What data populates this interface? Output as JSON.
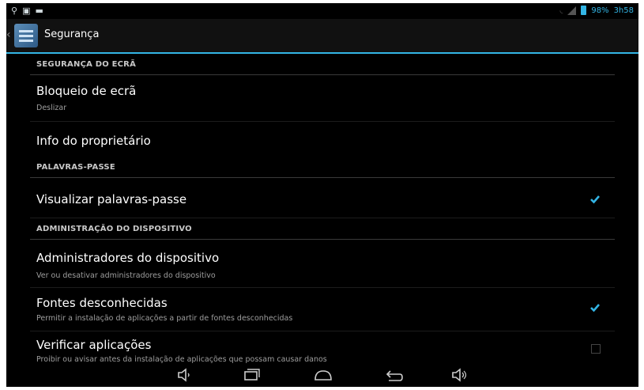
{
  "status": {
    "battery": "98%",
    "time": "3h58"
  },
  "header": {
    "title": "Segurança"
  },
  "sections": {
    "screen_security": "SEGURANÇA DO ECRÃ",
    "passwords": "PALAVRAS-PASSE",
    "device_admin": "ADMINISTRAÇÃO DO DISPOSITIVO"
  },
  "items": {
    "screen_lock": {
      "title": "Bloqueio de ecrã",
      "summary": "Deslizar"
    },
    "owner_info": {
      "title": "Info do proprietário"
    },
    "show_passwords": {
      "title": "Visualizar palavras-passe",
      "checked": true
    },
    "device_admins": {
      "title": "Administradores do dispositivo",
      "summary": "Ver ou desativar administradores do dispositivo"
    },
    "unknown_sources": {
      "title": "Fontes desconhecidas",
      "summary": "Permitir a instalação de aplicações a partir de fontes desconhecidas",
      "checked": true
    },
    "verify_apps": {
      "title": "Verificar aplicações",
      "summary": "Proibir ou avisar antes da instalação de aplicações que possam causar danos",
      "checked": false
    }
  },
  "icons": {
    "status_left": [
      "usb-icon",
      "image-icon",
      "notification-icon"
    ],
    "nav": [
      "volume-down-icon",
      "recent-apps-icon",
      "home-icon",
      "back-icon",
      "volume-up-icon"
    ]
  },
  "colors": {
    "accent": "#33b5e5",
    "background": "#000000"
  }
}
